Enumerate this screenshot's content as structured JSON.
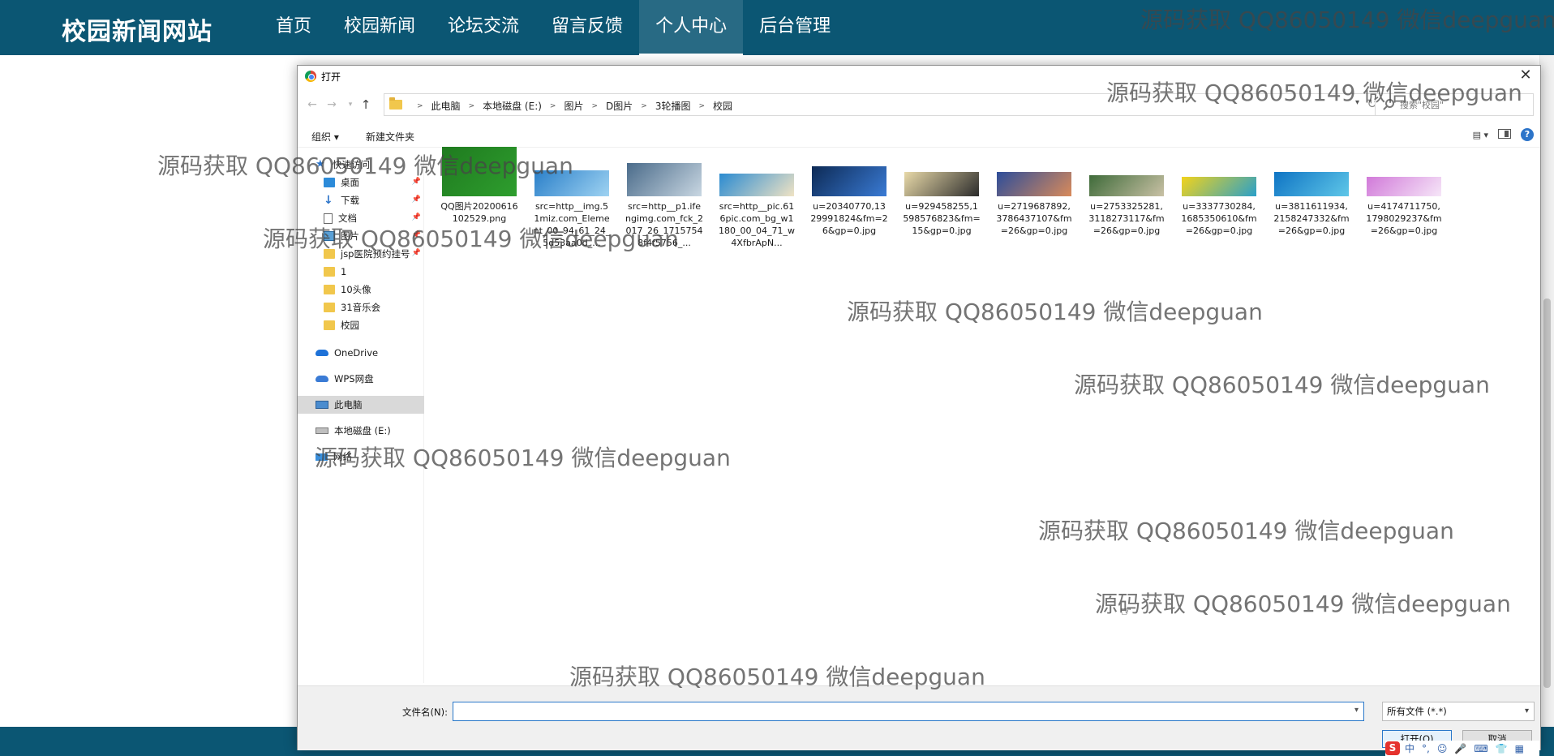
{
  "site": {
    "title": "校园新闻网站",
    "nav": [
      "首页",
      "校园新闻",
      "论坛交流",
      "留言反馈",
      "个人中心",
      "后台管理"
    ],
    "active_nav": "个人中心"
  },
  "dialog": {
    "title": "打开",
    "breadcrumb": [
      "此电脑",
      "本地磁盘 (E:)",
      "图片",
      "D图片",
      "3轮播图",
      "校园"
    ],
    "search_placeholder": "搜索\"校园\"",
    "toolbar": {
      "organize": "组织 ▾",
      "new_folder": "新建文件夹"
    },
    "nav_pane": {
      "quick_access": "快速访问",
      "items": [
        {
          "label": "桌面",
          "icon": "desktop-icon",
          "pinned": true
        },
        {
          "label": "下载",
          "icon": "download-icon",
          "pinned": true
        },
        {
          "label": "文档",
          "icon": "document-icon",
          "pinned": true
        },
        {
          "label": "图片",
          "icon": "pictures-icon",
          "pinned": true
        },
        {
          "label": "jsp医院预约挂号",
          "icon": "folder-icon",
          "pinned": true
        },
        {
          "label": "1",
          "icon": "folder-icon",
          "pinned": false
        },
        {
          "label": "10头像",
          "icon": "folder-icon",
          "pinned": false
        },
        {
          "label": "31音乐会",
          "icon": "folder-icon",
          "pinned": false
        },
        {
          "label": "校园",
          "icon": "folder-icon",
          "pinned": false
        }
      ],
      "onedrive": "OneDrive",
      "wps": "WPS网盘",
      "this_pc": "此电脑",
      "local_disk": "本地磁盘 (E:)",
      "network": "网络"
    },
    "files": [
      {
        "name": "QQ图片20200616102529.png",
        "thumb_colors": [
          "#1f7a1f",
          "#2e9e2e"
        ],
        "ratio": 0.66
      },
      {
        "name": "src=http__img.51miz.com_Element_00_94_61_24_5d53aa0d_...",
        "thumb_colors": [
          "#2a7fc9",
          "#9fd3f2"
        ],
        "ratio": 0.35
      },
      {
        "name": "src=http__p1.ifengimg.com_fck_2017_26_17157548f4f5756_...",
        "thumb_colors": [
          "#4a6b8a",
          "#c9d7e2"
        ],
        "ratio": 0.45
      },
      {
        "name": "src=http__pic.616pic.com_bg_w1180_00_04_71_w4XfbrApN...",
        "thumb_colors": [
          "#2b8bd1",
          "#f0e3c4"
        ],
        "ratio": 0.3
      },
      {
        "name": "u=20340770,1329991824&fm=26&gp=0.jpg",
        "thumb_colors": [
          "#0d2a55",
          "#3a7bd5"
        ],
        "ratio": 0.4
      },
      {
        "name": "u=929458255,1598576823&fm=15&gp=0.jpg",
        "thumb_colors": [
          "#e8d9a8",
          "#2b2b2b"
        ],
        "ratio": 0.33
      },
      {
        "name": "u=2719687892,3786437107&fm=26&gp=0.jpg",
        "thumb_colors": [
          "#2d4d9a",
          "#d98a5a"
        ],
        "ratio": 0.33
      },
      {
        "name": "u=2753325281,3118273117&fm=26&gp=0.jpg",
        "thumb_colors": [
          "#3f6b3a",
          "#c9c1a5"
        ],
        "ratio": 0.28
      },
      {
        "name": "u=3337730284,1685350610&fm=26&gp=0.jpg",
        "thumb_colors": [
          "#f2d31b",
          "#2aa0c9"
        ],
        "ratio": 0.26
      },
      {
        "name": "u=3811611934,2158247332&fm=26&gp=0.jpg",
        "thumb_colors": [
          "#0f74c4",
          "#5fc7e8"
        ],
        "ratio": 0.33
      },
      {
        "name": "u=4174711750,1798029237&fm=26&gp=0.jpg",
        "thumb_colors": [
          "#d17ad9",
          "#f6e6f8"
        ],
        "ratio": 0.26
      }
    ],
    "filename_label": "文件名(N):",
    "filename_value": "",
    "filetype": "所有文件 (*.*)",
    "open_label": "打开(O)",
    "cancel_label": "取消"
  },
  "ime": {
    "logo": "S",
    "items": [
      "中",
      "°,",
      "☺",
      "🎤",
      "⌨",
      "👕",
      "▦"
    ]
  },
  "watermark": "源码获取 QQ86050149 微信deepguan"
}
